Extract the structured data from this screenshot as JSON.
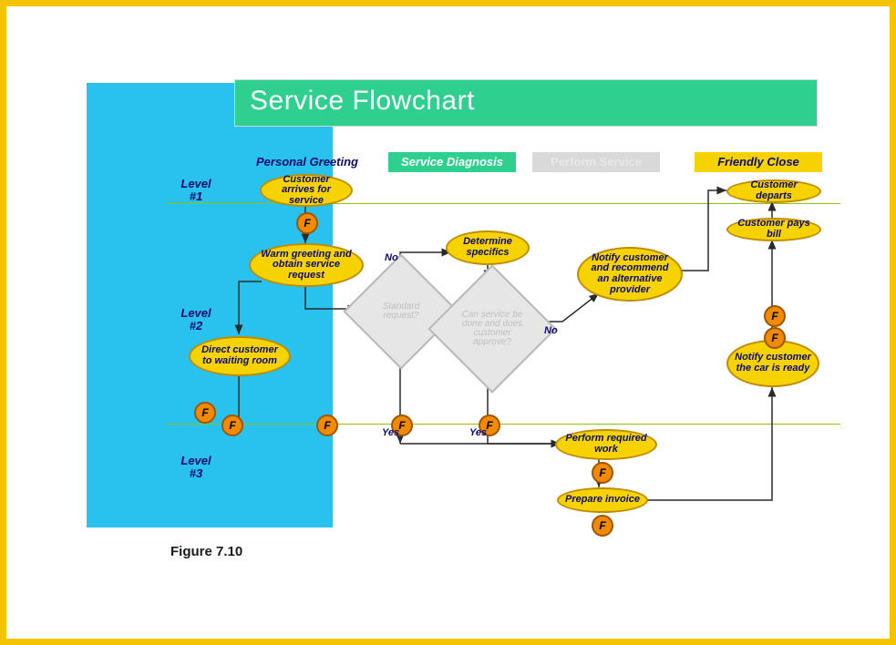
{
  "title": "Service Flowchart",
  "columns": {
    "personal": "Personal Greeting",
    "diagnosis": "Service Diagnosis",
    "perform": "Perform Service",
    "close": "Friendly Close"
  },
  "levels": {
    "l1a": "Level",
    "l1b": "#1",
    "l2a": "Level",
    "l2b": "#2",
    "l3a": "Level",
    "l3b": "#3"
  },
  "nodes": {
    "arrive": "Customer arrives for service",
    "warm": "Warm greeting and obtain service request",
    "direct": "Direct customer to waiting room",
    "determine": "Determine specifics",
    "notify_alt": "Notify customer and recommend an alternative provider",
    "perform": "Perform required work",
    "prepare": "Prepare invoice",
    "notify_ready": "Notify customer the car is ready",
    "pays": "Customer pays bill",
    "departs": "Customer departs"
  },
  "decisions": {
    "standard": "Standard request?",
    "can_do": "Can service be done and does customer approve?"
  },
  "edge_labels": {
    "no1": "No",
    "no2": "No",
    "yes1": "Yes",
    "yes2": "Yes"
  },
  "marker": "F",
  "figure": "Figure 7.10"
}
